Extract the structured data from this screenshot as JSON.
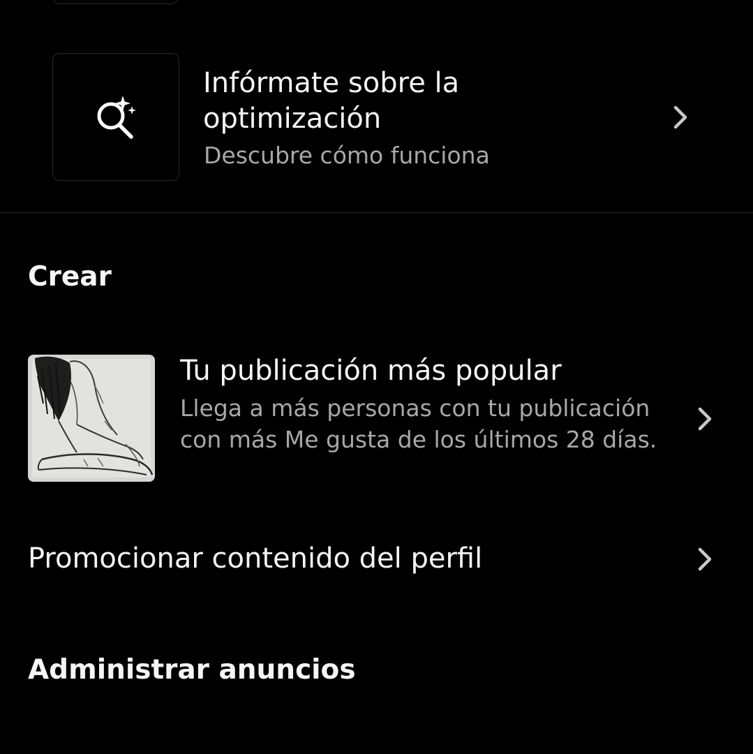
{
  "learn": {
    "title": "Infórmate sobre la optimización",
    "subtitle": "Descubre cómo funciona",
    "icon": "search-sparkle-icon"
  },
  "sections": {
    "create": "Crear",
    "manage": "Administrar anuncios"
  },
  "popular_post": {
    "title": "Tu publicación más popular",
    "description": "Llega a más personas con tu publicación con más Me gusta de los últimos 28 días.",
    "thumbnail": "pencil-sketch-figure-image"
  },
  "promote_profile": {
    "label": "Promocionar contenido del perfil"
  },
  "colors": {
    "background": "#000000",
    "primary_text": "#f5f5f5",
    "secondary_text": "#a8a8a8",
    "border": "#2a2a2a",
    "chevron": "#c8c8c8"
  }
}
